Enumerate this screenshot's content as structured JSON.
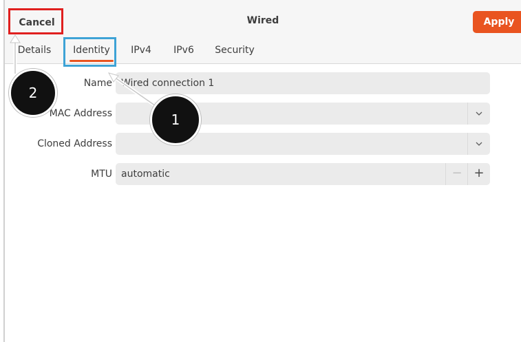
{
  "header": {
    "cancel_label": "Cancel",
    "title": "Wired",
    "apply_label": "Apply",
    "accent_color": "#e95420"
  },
  "tabs": [
    {
      "label": "Details",
      "active": false
    },
    {
      "label": "Identity",
      "active": true
    },
    {
      "label": "IPv4",
      "active": false
    },
    {
      "label": "IPv6",
      "active": false
    },
    {
      "label": "Security",
      "active": false
    }
  ],
  "form": {
    "name": {
      "label": "Name",
      "value": "Wired connection 1"
    },
    "mac_address": {
      "label": "MAC Address",
      "value": "",
      "icon": "chevron-down-icon"
    },
    "cloned_address": {
      "label": "Cloned Address",
      "value": "",
      "icon": "chevron-down-icon"
    },
    "mtu": {
      "label": "MTU",
      "value": "automatic",
      "minus": "−",
      "plus": "+"
    }
  },
  "annotations": {
    "callout_1": "1",
    "callout_2": "2",
    "highlight_red": "#e0201f",
    "highlight_blue": "#3ea3d6"
  }
}
